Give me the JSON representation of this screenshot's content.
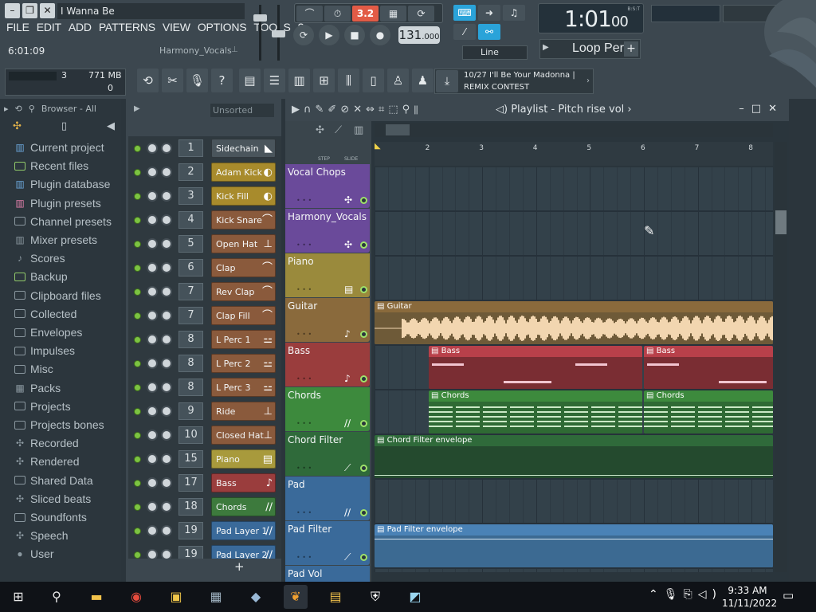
{
  "window": {
    "song_title": "I Wanna Be",
    "btn_minimize": "–",
    "btn_restore": "❐",
    "btn_close": "✕"
  },
  "menu": [
    "FILE",
    "EDIT",
    "ADD",
    "PATTERNS",
    "VIEW",
    "OPTIONS",
    "TOOLS",
    "?"
  ],
  "hint": {
    "time": "6:01:09",
    "target": "Harmony_Vocals"
  },
  "transport": {
    "pattern_mode_value": "3.2",
    "tempo_main": "131",
    "tempo_frac": ".000",
    "snap_label": "Line",
    "song_position_big": "1:01",
    "song_position_small": "00",
    "position_unit": "B:S:T",
    "pattern_name": "Loop Perc",
    "pattern_add": "+"
  },
  "performance": {
    "cpu": "3",
    "memory": "771 MB",
    "polyphony": "0"
  },
  "news": {
    "line1": "10/27  I'll Be Your Madonna |",
    "line2": "REMIX CONTEST"
  },
  "browser": {
    "header": "Browser - All",
    "items": [
      {
        "label": "Current project",
        "icon": "project-icon",
        "accent": "blue"
      },
      {
        "label": "Recent files",
        "icon": "folder-icon",
        "accent": "green"
      },
      {
        "label": "Plugin database",
        "icon": "plugin-icon",
        "accent": "blue"
      },
      {
        "label": "Plugin presets",
        "icon": "plugin-icon",
        "accent": "pink"
      },
      {
        "label": "Channel presets",
        "icon": "folder-icon",
        "accent": "none"
      },
      {
        "label": "Mixer presets",
        "icon": "mixer-icon",
        "accent": "none"
      },
      {
        "label": "Scores",
        "icon": "note-icon",
        "accent": "none"
      },
      {
        "label": "Backup",
        "icon": "folder-icon",
        "accent": "green"
      },
      {
        "label": "Clipboard files",
        "icon": "folder-icon",
        "accent": "none"
      },
      {
        "label": "Collected",
        "icon": "folder-icon",
        "accent": "none"
      },
      {
        "label": "Envelopes",
        "icon": "folder-icon",
        "accent": "none"
      },
      {
        "label": "Impulses",
        "icon": "folder-icon",
        "accent": "none"
      },
      {
        "label": "Misc",
        "icon": "folder-icon",
        "accent": "none"
      },
      {
        "label": "Packs",
        "icon": "packs-icon",
        "accent": "none"
      },
      {
        "label": "Projects",
        "icon": "folder-icon",
        "accent": "none"
      },
      {
        "label": "Projects bones",
        "icon": "folder-icon",
        "accent": "none"
      },
      {
        "label": "Recorded",
        "icon": "recorded-icon",
        "accent": "none"
      },
      {
        "label": "Rendered",
        "icon": "rendered-icon",
        "accent": "none"
      },
      {
        "label": "Shared Data",
        "icon": "folder-icon",
        "accent": "none"
      },
      {
        "label": "Sliced beats",
        "icon": "sliced-icon",
        "accent": "none"
      },
      {
        "label": "Soundfonts",
        "icon": "folder-icon",
        "accent": "none"
      },
      {
        "label": "Speech",
        "icon": "speech-icon",
        "accent": "none"
      },
      {
        "label": "User",
        "icon": "user-icon",
        "accent": "none"
      }
    ]
  },
  "rack": {
    "filter": "Unsorted",
    "add_label": "+",
    "channels": [
      {
        "num": "1",
        "name": "Sidechain",
        "color": "#4a555c",
        "glyph": "◣"
      },
      {
        "num": "2",
        "name": "Adam Kick",
        "color": "#a88b2c",
        "glyph": "◐"
      },
      {
        "num": "3",
        "name": "Kick Fill",
        "color": "#a88b2c",
        "glyph": "◐"
      },
      {
        "num": "4",
        "name": "Kick Snare",
        "color": "#8a5a3c",
        "glyph": "⌒"
      },
      {
        "num": "5",
        "name": "Open Hat",
        "color": "#8a5a3c",
        "glyph": "⊥"
      },
      {
        "num": "6",
        "name": "Clap",
        "color": "#8a5a3c",
        "glyph": "⌒"
      },
      {
        "num": "7",
        "name": "Rev Clap",
        "color": "#8a5a3c",
        "glyph": "⌒"
      },
      {
        "num": "7",
        "name": "Clap Fill",
        "color": "#8a5a3c",
        "glyph": "⌒"
      },
      {
        "num": "8",
        "name": "L Perc 1",
        "color": "#8a5a3c",
        "glyph": "⚍"
      },
      {
        "num": "8",
        "name": "L Perc 2",
        "color": "#8a5a3c",
        "glyph": "⚍"
      },
      {
        "num": "8",
        "name": "L Perc 3",
        "color": "#8a5a3c",
        "glyph": "⚍"
      },
      {
        "num": "9",
        "name": "Ride",
        "color": "#8a5a3c",
        "glyph": "⊥"
      },
      {
        "num": "10",
        "name": "Closed Hat",
        "color": "#8a5a3c",
        "glyph": "⊥"
      },
      {
        "num": "15",
        "name": "Piano",
        "color": "#a89a3c",
        "glyph": "▤"
      },
      {
        "num": "17",
        "name": "Bass",
        "color": "#9a3d3d",
        "glyph": "♪"
      },
      {
        "num": "18",
        "name": "Chords",
        "color": "#3d7a3d",
        "glyph": "∕∕"
      },
      {
        "num": "19",
        "name": "Pad Layer 1",
        "color": "#3a6a9a",
        "glyph": "∕∕"
      },
      {
        "num": "19",
        "name": "Pad Layer 2",
        "color": "#3a6a9a",
        "glyph": "∕∕"
      }
    ]
  },
  "playlist": {
    "title": "Playlist - Pitch rise vol",
    "step_label": "STEP",
    "slide_label": "SLIDE",
    "ruler": [
      "2",
      "3",
      "4",
      "5",
      "6",
      "7",
      "8"
    ],
    "tracks": [
      {
        "name": "Vocal Chops",
        "color": "#6a4a9a",
        "glyph": "✣"
      },
      {
        "name": "Harmony_Vocals",
        "color": "#6a4a9a",
        "glyph": "✣"
      },
      {
        "name": "Piano",
        "color": "#9a8a3c",
        "glyph": "▤"
      },
      {
        "name": "Guitar",
        "color": "#8a6a3c",
        "glyph": "♪"
      },
      {
        "name": "Bass",
        "color": "#9a3d3d",
        "glyph": "♪"
      },
      {
        "name": "Chords",
        "color": "#3d8a3d",
        "glyph": "∕∕"
      },
      {
        "name": "Chord Filter",
        "color": "#2f6a3a",
        "glyph": "⟋"
      },
      {
        "name": "Pad",
        "color": "#3a6a9a",
        "glyph": "∕∕"
      },
      {
        "name": "Pad Filter",
        "color": "#3a6a9a",
        "glyph": "⟋"
      },
      {
        "name": "Pad Vol",
        "color": "#3a6a9a",
        "glyph": "⟋"
      }
    ],
    "clips": {
      "guitar": "Guitar",
      "bass_a": "Bass",
      "bass_b": "Bass",
      "chords_a": "Chords",
      "chords_b": "Chords",
      "chord_filter": "Chord Filter envelope",
      "pad_filter": "Pad Filter envelope"
    }
  },
  "taskbar": {
    "time": "9:33 AM",
    "date": "11/11/2022"
  },
  "colors": {
    "accent_blue": "#2aa3d9",
    "pattern_red": "#e25b46",
    "led_green": "#7cc342"
  }
}
